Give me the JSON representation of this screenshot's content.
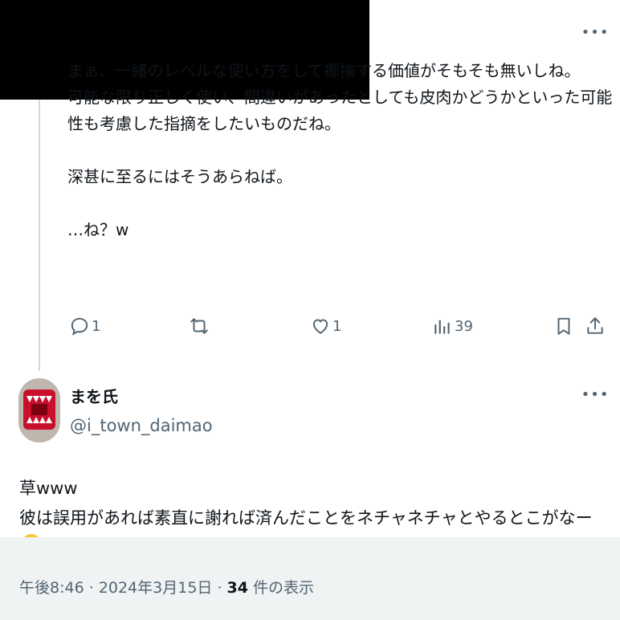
{
  "first_post": {
    "text": "まぁ、一緒のレベルな使い方をして揶揄する価値がそもそも無いしね。\n可能な限り正しく使い、間違いがあったとしても皮肉かどうかといった可能性も考慮した指摘をしたいものだね。\n\n深甚に至るにはそうあらねば。\n\n…ね？w",
    "more_icon": "more-horizontal-icon",
    "actions": {
      "reply_count": "1",
      "repost_count": "",
      "like_count": "1",
      "views_count": "39"
    }
  },
  "reply_post": {
    "author_name": "まを氏",
    "author_handle": "@i_town_daimao",
    "text": "草www\n彼は誤用があれば素直に謝れば済んだことをネチャネチャとやるとこがなー",
    "emoji": "face-with-hand-over-mouth"
  },
  "footer": {
    "time": "午後8:46",
    "sep1": " · ",
    "date": "2024年3月15日",
    "sep2": " · ",
    "views_number": "34",
    "views_label": " 件の表示"
  },
  "colors": {
    "text": "#0f1419",
    "secondary": "#536471",
    "thread_line": "#cfd9de",
    "footer_bg": "#eff3f4",
    "redaction": "#000000"
  }
}
